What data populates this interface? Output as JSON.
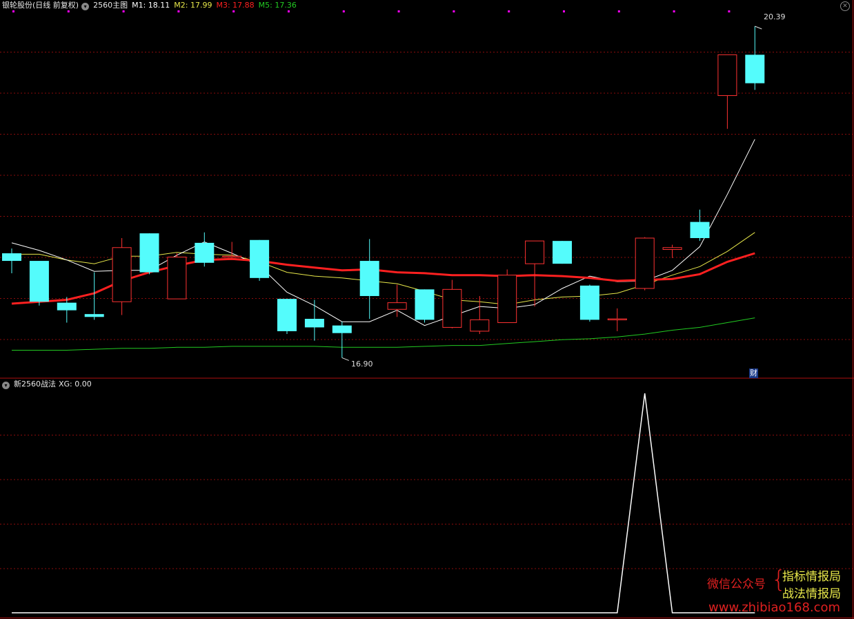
{
  "main_header": {
    "stock_name": "银轮股份(日线 前复权)",
    "indicator_name": "2560主图",
    "m1": "M1: 18.11",
    "m2": "M2: 17.99",
    "m3": "M3: 17.88",
    "m5": "M5: 17.36"
  },
  "sub_header": {
    "indicator_name": "新2560战法",
    "xg": "XG: 0.00"
  },
  "annotations": {
    "high": "20.39",
    "low": "16.90",
    "fin_badge": "财"
  },
  "watermark": {
    "left": "微信公众号",
    "right_top": "指标情报局",
    "right_bottom": "战法情报局",
    "url": "www.zhibiao168.com"
  },
  "colors": {
    "up": "#ff3232",
    "down": "#54fcfc",
    "m1": "#ffffff",
    "m2": "#e8e84a",
    "m3": "#ff2020",
    "m5": "#22cc22",
    "magenta": "#ff00ff",
    "axis": "#b01010"
  },
  "chart_data": {
    "type": "candlestick",
    "price_range": [
      16.7,
      20.55
    ],
    "candles": [
      {
        "o": 18.0,
        "h": 18.05,
        "l": 17.79,
        "c": 17.92
      },
      {
        "o": 17.92,
        "h": 17.92,
        "l": 17.45,
        "c": 17.49
      },
      {
        "o": 17.48,
        "h": 17.54,
        "l": 17.27,
        "c": 17.4
      },
      {
        "o": 17.36,
        "h": 17.8,
        "l": 17.3,
        "c": 17.33
      },
      {
        "o": 17.49,
        "h": 18.16,
        "l": 17.35,
        "c": 18.06
      },
      {
        "o": 18.21,
        "h": 18.21,
        "l": 17.78,
        "c": 17.8
      },
      {
        "o": 17.52,
        "h": 18.0,
        "l": 17.52,
        "c": 17.96
      },
      {
        "o": 18.11,
        "h": 18.22,
        "l": 17.86,
        "c": 17.9
      },
      {
        "o": 17.97,
        "h": 18.12,
        "l": 17.97,
        "c": 17.97
      },
      {
        "o": 18.14,
        "h": 18.14,
        "l": 17.71,
        "c": 17.74
      },
      {
        "o": 17.52,
        "h": 17.52,
        "l": 17.15,
        "c": 17.18
      },
      {
        "o": 17.31,
        "h": 17.51,
        "l": 17.08,
        "c": 17.22
      },
      {
        "o": 17.24,
        "h": 17.28,
        "l": 16.9,
        "c": 17.16
      },
      {
        "o": 17.92,
        "h": 18.15,
        "l": 17.31,
        "c": 17.55
      },
      {
        "o": 17.41,
        "h": 17.67,
        "l": 17.33,
        "c": 17.48
      },
      {
        "o": 17.62,
        "h": 17.62,
        "l": 17.27,
        "c": 17.3
      },
      {
        "o": 17.22,
        "h": 17.72,
        "l": 17.21,
        "c": 17.62
      },
      {
        "o": 17.18,
        "h": 17.55,
        "l": 17.15,
        "c": 17.3
      },
      {
        "o": 17.27,
        "h": 17.83,
        "l": 17.27,
        "c": 17.77
      },
      {
        "o": 17.89,
        "h": 18.12,
        "l": 17.44,
        "c": 18.13
      },
      {
        "o": 18.13,
        "h": 18.13,
        "l": 17.89,
        "c": 17.89
      },
      {
        "o": 17.66,
        "h": 17.67,
        "l": 17.28,
        "c": 17.3
      },
      {
        "o": 17.31,
        "h": 17.42,
        "l": 17.18,
        "c": 17.31
      },
      {
        "o": 17.63,
        "h": 18.17,
        "l": 17.61,
        "c": 18.16
      },
      {
        "o": 18.04,
        "h": 18.09,
        "l": 17.95,
        "c": 18.06
      },
      {
        "o": 18.33,
        "h": 18.46,
        "l": 18.13,
        "c": 18.16
      },
      {
        "o": 19.66,
        "h": 20.05,
        "l": 19.31,
        "c": 20.09
      },
      {
        "o": 20.09,
        "h": 20.39,
        "l": 19.72,
        "c": 19.79
      }
    ],
    "m1": [
      18.11,
      18.03,
      17.93,
      17.81,
      17.82,
      17.82,
      17.98,
      18.12,
      18.0,
      17.87,
      17.59,
      17.45,
      17.28,
      17.28,
      17.4,
      17.24,
      17.34,
      17.44,
      17.42,
      17.46,
      17.63,
      17.76,
      17.7,
      17.71,
      17.82,
      18.07,
      18.62,
      19.2
    ],
    "m2": [
      17.99,
      17.99,
      17.93,
      17.89,
      17.97,
      17.97,
      18.01,
      17.99,
      17.98,
      17.91,
      17.8,
      17.76,
      17.74,
      17.71,
      17.68,
      17.6,
      17.51,
      17.49,
      17.46,
      17.51,
      17.54,
      17.55,
      17.58,
      17.67,
      17.77,
      17.86,
      18.02,
      18.22
    ],
    "m3": [
      17.47,
      17.49,
      17.51,
      17.58,
      17.71,
      17.8,
      17.87,
      17.93,
      17.94,
      17.92,
      17.88,
      17.85,
      17.82,
      17.83,
      17.8,
      17.79,
      17.77,
      17.77,
      17.76,
      17.77,
      17.76,
      17.74,
      17.71,
      17.72,
      17.73,
      17.78,
      17.91,
      18.0
    ],
    "m5": [
      16.98,
      16.98,
      16.98,
      16.99,
      17.0,
      17.0,
      17.01,
      17.01,
      17.02,
      17.02,
      17.02,
      17.02,
      17.01,
      17.01,
      17.01,
      17.02,
      17.03,
      17.03,
      17.05,
      17.07,
      17.09,
      17.1,
      17.12,
      17.15,
      17.19,
      17.22,
      17.27,
      17.32
    ],
    "xg": [
      0,
      0,
      0,
      0,
      0,
      0,
      0,
      0,
      0,
      0,
      0,
      0,
      0,
      0,
      0,
      0,
      0,
      0,
      0,
      0,
      0,
      0,
      0,
      1,
      0,
      0,
      0,
      0
    ],
    "xg_range": [
      0,
      1
    ]
  }
}
